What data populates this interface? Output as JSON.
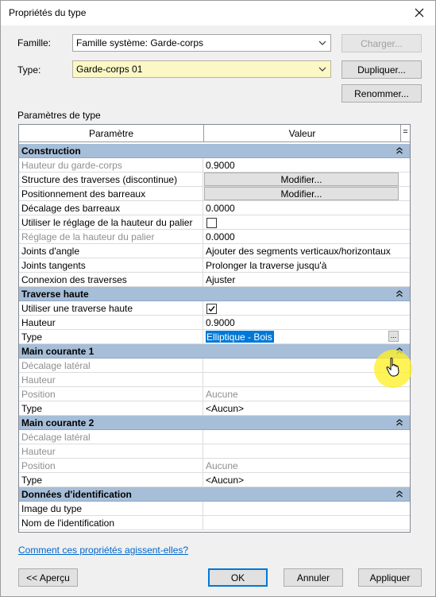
{
  "window": {
    "title": "Propriétés du type"
  },
  "header": {
    "famille_label": "Famille:",
    "famille_value": "Famille système: Garde-corps",
    "type_label": "Type:",
    "type_value": "Garde-corps 01",
    "charger_label": "Charger...",
    "dupliquer_label": "Dupliquer...",
    "renommer_label": "Renommer..."
  },
  "section_label": "Paramètres de type",
  "grid": {
    "col_param": "Paramètre",
    "col_value": "Valeur",
    "col_eq": "=",
    "rows": [
      {
        "kind": "group",
        "label": "Construction"
      },
      {
        "kind": "row",
        "param": "Hauteur du garde-corps",
        "value": "0.9000",
        "dim": true
      },
      {
        "kind": "button",
        "param": "Structure des traverses (discontinue)",
        "value": "Modifier..."
      },
      {
        "kind": "button",
        "param": "Positionnement des barreaux",
        "value": "Modifier..."
      },
      {
        "kind": "row",
        "param": "Décalage des barreaux",
        "value": "0.0000"
      },
      {
        "kind": "check",
        "param": "Utiliser le réglage de la hauteur du palier",
        "checked": false
      },
      {
        "kind": "row",
        "param": "Réglage de la hauteur du palier",
        "value": "0.0000",
        "dim": true
      },
      {
        "kind": "row",
        "param": "Joints d'angle",
        "value": "Ajouter des segments verticaux/horizontaux"
      },
      {
        "kind": "row",
        "param": "Joints tangents",
        "value": "Prolonger la traverse jusqu'à"
      },
      {
        "kind": "row",
        "param": "Connexion des traverses",
        "value": "Ajuster"
      },
      {
        "kind": "group",
        "label": "Traverse haute"
      },
      {
        "kind": "check",
        "param": "Utiliser une traverse haute",
        "checked": true
      },
      {
        "kind": "row",
        "param": "Hauteur",
        "value": "0.9000"
      },
      {
        "kind": "edit",
        "param": "Type",
        "value": "Elliptique - Bois"
      },
      {
        "kind": "group",
        "label": "Main courante 1"
      },
      {
        "kind": "row",
        "param": "Décalage latéral",
        "value": "",
        "dim": true
      },
      {
        "kind": "row",
        "param": "Hauteur",
        "value": "",
        "dim": true
      },
      {
        "kind": "row",
        "param": "Position",
        "value": "Aucune",
        "dim": true,
        "valdim": true
      },
      {
        "kind": "row",
        "param": "Type",
        "value": "<Aucun>"
      },
      {
        "kind": "group",
        "label": "Main courante 2"
      },
      {
        "kind": "row",
        "param": "Décalage latéral",
        "value": "",
        "dim": true
      },
      {
        "kind": "row",
        "param": "Hauteur",
        "value": "",
        "dim": true
      },
      {
        "kind": "row",
        "param": "Position",
        "value": "Aucune",
        "dim": true,
        "valdim": true
      },
      {
        "kind": "row",
        "param": "Type",
        "value": "<Aucun>"
      },
      {
        "kind": "group",
        "label": "Données d'identification"
      },
      {
        "kind": "row",
        "param": "Image du type",
        "value": ""
      },
      {
        "kind": "row",
        "param": "Nom de l'identification",
        "value": ""
      }
    ]
  },
  "help_link": "Comment ces propriétés agissent-elles?",
  "footer": {
    "apercu_label": "<< Aperçu",
    "ok_label": "OK",
    "annuler_label": "Annuler",
    "appliquer_label": "Appliquer"
  }
}
